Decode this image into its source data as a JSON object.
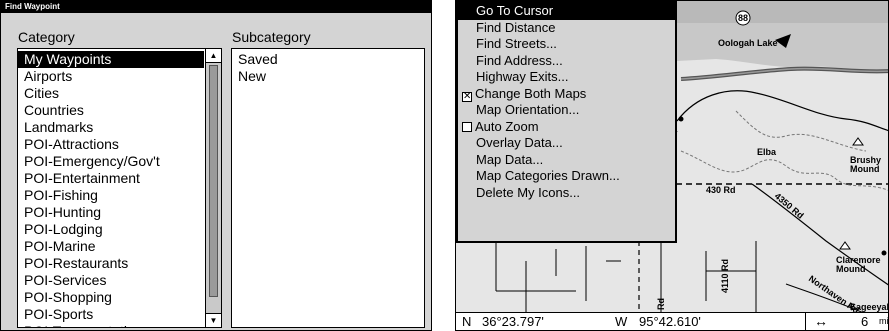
{
  "find_waypoint": {
    "title": "Find Waypoint",
    "category_header": "Category",
    "subcategory_header": "Subcategory",
    "categories": [
      "My Waypoints",
      "Airports",
      "Cities",
      "Countries",
      "Landmarks",
      "POI-Attractions",
      "POI-Emergency/Gov't",
      "POI-Entertainment",
      "POI-Fishing",
      "POI-Hunting",
      "POI-Lodging",
      "POI-Marine",
      "POI-Restaurants",
      "POI-Services",
      "POI-Shopping",
      "POI-Sports",
      "POI-Transportation"
    ],
    "selected_category": "My Waypoints",
    "subcategories": [
      "Saved",
      "New"
    ]
  },
  "map_menu": {
    "items": [
      {
        "label": "Go To Cursor",
        "selected": true,
        "checkbox": null
      },
      {
        "label": "Find Distance",
        "selected": false,
        "checkbox": null
      },
      {
        "label": "Find Streets...",
        "selected": false,
        "checkbox": null
      },
      {
        "label": "Find Address...",
        "selected": false,
        "checkbox": null
      },
      {
        "label": "Highway Exits...",
        "selected": false,
        "checkbox": null
      },
      {
        "label": "Change Both Maps",
        "selected": false,
        "checkbox": true
      },
      {
        "label": "Map Orientation...",
        "selected": false,
        "checkbox": null
      },
      {
        "label": "Auto Zoom",
        "selected": false,
        "checkbox": false
      },
      {
        "label": "Overlay Data...",
        "selected": false,
        "checkbox": null
      },
      {
        "label": "Map Data...",
        "selected": false,
        "checkbox": null
      },
      {
        "label": "Map Categories Drawn...",
        "selected": false,
        "checkbox": null
      },
      {
        "label": "Delete My Icons...",
        "selected": false,
        "checkbox": null
      }
    ]
  },
  "map": {
    "labels": {
      "highway_88": "88",
      "oologah_lake": "Oologah Lake",
      "elba": "Elba",
      "brushy": "Brushy",
      "mound": "Mound",
      "rd_430": "430 Rd",
      "rd_4350": "4350 Rd",
      "claremore": "Claremore",
      "claremore_mound": "Mound",
      "northaven_rd": "Northaven Rd",
      "rd_4110": "4110 Rd",
      "rd": "Rd",
      "sageeyah": "Sageeyah"
    }
  },
  "status": {
    "lat_hemisphere": "N",
    "latitude": "36°23.797'",
    "lon_hemisphere": "W",
    "longitude": "95°42.610'",
    "scale_icon": "double-arrow-icon",
    "scale_value": "6",
    "scale_unit": "mi"
  }
}
